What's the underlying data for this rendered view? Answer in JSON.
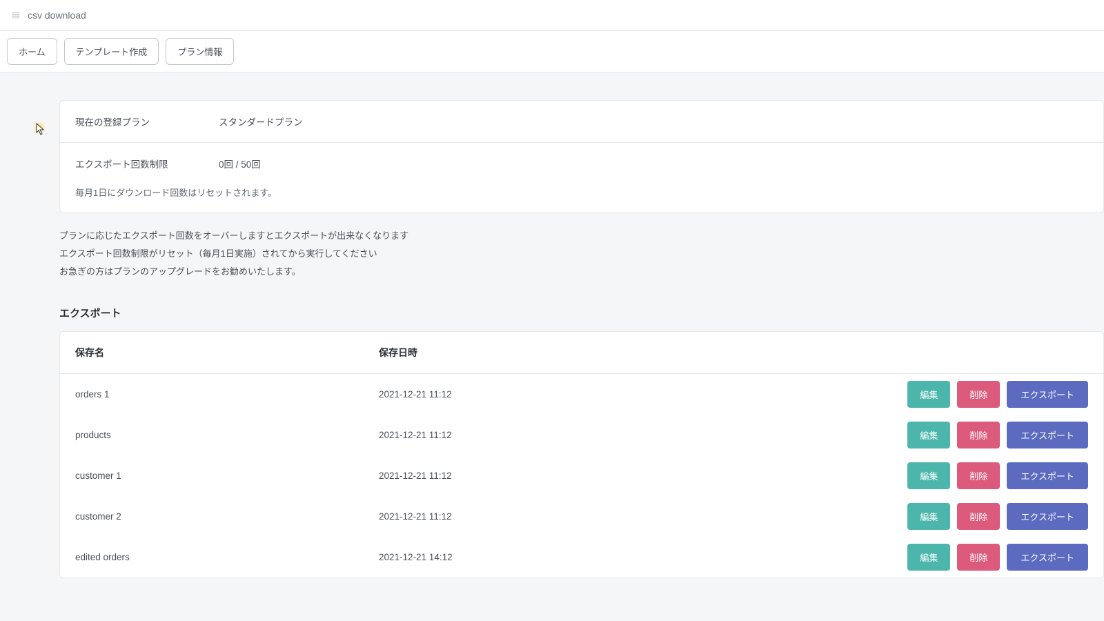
{
  "header": {
    "title": "csv download"
  },
  "nav": {
    "home": "ホーム",
    "create_template": "テンプレート作成",
    "plan_info": "プラン情報"
  },
  "plan": {
    "plan_label": "現在の登録プラン",
    "plan_value": "スタンダードプラン",
    "limit_label": "エクスポート回数制限",
    "limit_value": "0回 / 50回",
    "reset_note": "毎月1日にダウンロード回数はリセットされます。"
  },
  "info": {
    "line1": "プランに応じたエクスポート回数をオーバーしますとエクスポートが出来なくなります",
    "line2": "エクスポート回数制限がリセット（毎月1日実施）されてから実行してください",
    "line3": "お急ぎの方はプランのアップグレードをお勧めいたします。"
  },
  "section": {
    "export_title": "エクスポート"
  },
  "table": {
    "head_name": "保存名",
    "head_date": "保存日時",
    "btn_edit": "編集",
    "btn_delete": "削除",
    "btn_export": "エクスポート",
    "rows": [
      {
        "name": "orders 1",
        "date": "2021-12-21 11:12"
      },
      {
        "name": "products",
        "date": "2021-12-21 11:12"
      },
      {
        "name": "customer 1",
        "date": "2021-12-21 11:12"
      },
      {
        "name": "customer 2",
        "date": "2021-12-21 11:12"
      },
      {
        "name": "edited orders",
        "date": "2021-12-21 14:12"
      }
    ]
  }
}
